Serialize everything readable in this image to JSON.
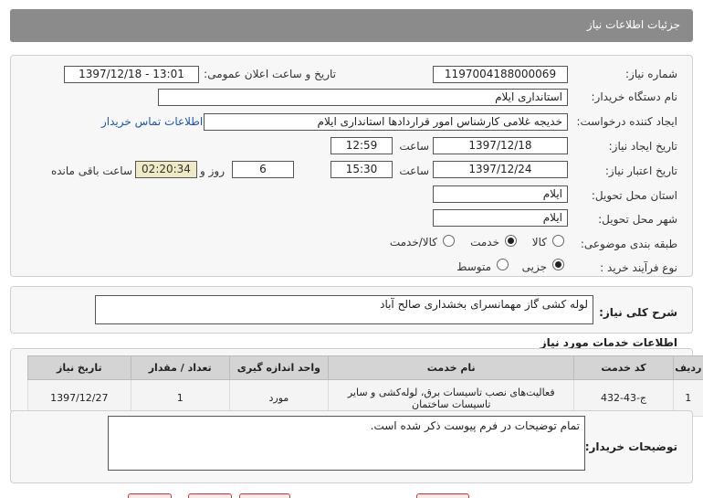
{
  "header": {
    "title": "جزئیات اطلاعات نیاز"
  },
  "form": {
    "need_number_label": "شماره نیاز:",
    "need_number": "1197004188000069",
    "announce_label": "تاریخ و ساعت اعلان عمومی:",
    "announce_value": "1397/12/18 - 13:01",
    "buyer_org_label": "نام دستگاه خریدار:",
    "buyer_org": "استانداری ایلام",
    "creator_label": "ایجاد کننده درخواست:",
    "creator": "خدیجه غلامی کارشناس امور قراردادها استانداری ایلام",
    "contact_link": "اطلاعات تماس خریدار",
    "created_date_label": "تاریخ ایجاد نیاز:",
    "created_date": "1397/12/18",
    "time_label": "ساعت",
    "created_time": "12:59",
    "validity_label": "تاریخ اعتبار نیاز:",
    "validity_date": "1397/12/24",
    "validity_time": "15:30",
    "days_value": "6",
    "days_label": "روز و",
    "remaining_time": "02:20:34",
    "remaining_label": "ساعت باقی مانده",
    "province_label": "استان محل تحویل:",
    "province": "ایلام",
    "city_label": "شهر محل تحویل:",
    "city": "ایلام",
    "category_label": "طبقه بندی موضوعی:",
    "category_options": [
      "کالا",
      "خدمت",
      "کالا/خدمت"
    ],
    "category_selected": "خدمت",
    "process_label": "نوع فرآیند خرید :",
    "process_options": [
      "جزیی",
      "متوسط"
    ],
    "process_selected": "جزیی"
  },
  "summary": {
    "label": "شرح کلی نیاز:",
    "text": "لوله کشی گاز  مهمانسرای بخشداری صالح آباد"
  },
  "services": {
    "title": "اطلاعات خدمات مورد نیاز",
    "columns": [
      "ردیف",
      "کد خدمت",
      "نام خدمت",
      "واحد اندازه گیری",
      "تعداد / مقدار",
      "تاریخ نیاز"
    ],
    "rows": [
      {
        "row": "1",
        "code": "ج-43-432",
        "name": "فعالیت‌های نصب تاسیسات برق، لوله‌کشی و سایر تاسیسات ساختمان",
        "unit": "مورد",
        "qty": "1",
        "date": "1397/12/27"
      }
    ]
  },
  "buyer_notes": {
    "label": "توضیحات خریدار:",
    "text": "تمام توضیحات در فرم پیوست ذکر شده است."
  }
}
